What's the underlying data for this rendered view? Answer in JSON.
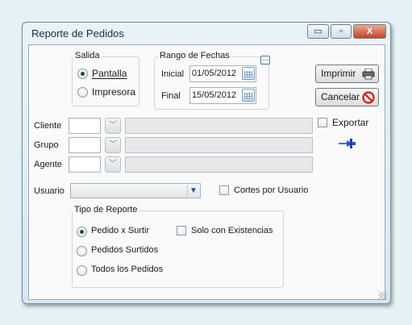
{
  "window": {
    "title": "Reporte de Pedidos",
    "minimize_glyph": "▭",
    "maximize_glyph": "▫",
    "close_glyph": "X",
    "accent": "#c1452a"
  },
  "salida": {
    "legend": "Salida",
    "options": [
      {
        "label": "Pantalla",
        "selected": true
      },
      {
        "label": "Impresora",
        "selected": false
      }
    ]
  },
  "rango": {
    "legend": "Rango de Fechas",
    "extra_button": "...",
    "inicial_label": "Inicial",
    "inicial_value": "01/05/2012",
    "final_label": "Final",
    "final_value": "15/05/2012"
  },
  "buttons": {
    "imprimir": "Imprimir",
    "cancelar": "Cancelar"
  },
  "filters": {
    "cliente_label": "Cliente",
    "grupo_label": "Grupo",
    "agente_label": "Agente",
    "exportar_label": "Exportar",
    "exportar_checked": false
  },
  "usuario": {
    "label": "Usuario",
    "value": "",
    "cortes_label": "Cortes por Usuario",
    "cortes_checked": false
  },
  "tipo": {
    "legend": "Tipo de Reporte",
    "options": [
      {
        "label": "Pedido x Surtir",
        "selected": true
      },
      {
        "label": "Pedidos Surtidos",
        "selected": false
      },
      {
        "label": "Todos los Pedidos",
        "selected": false
      }
    ],
    "solo_label": "Solo con Existencias",
    "solo_checked": false
  }
}
